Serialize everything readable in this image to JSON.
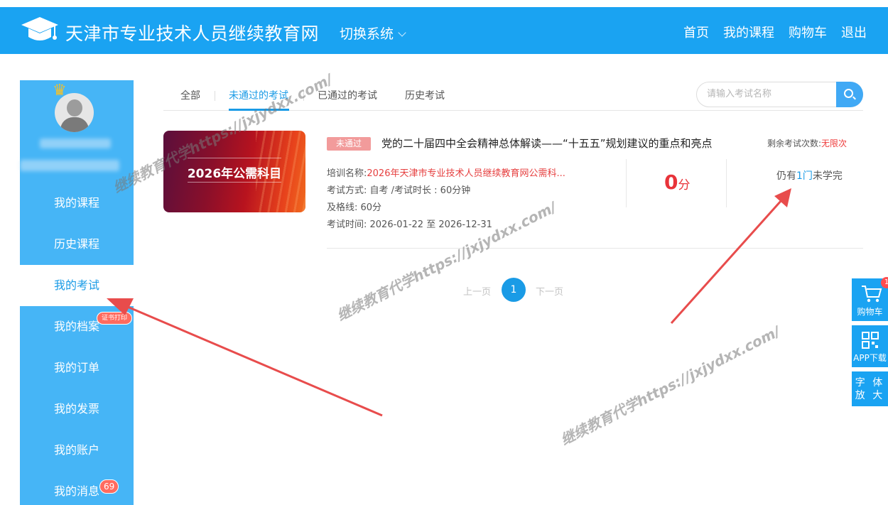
{
  "header": {
    "site_title": "天津市专业技术人员继续教育网",
    "switch_system": "切换系统",
    "nav": [
      "首页",
      "我的课程",
      "购物车",
      "退出"
    ]
  },
  "sidebar": {
    "items": [
      {
        "label": "我的课程"
      },
      {
        "label": "历史课程"
      },
      {
        "label": "我的考试"
      },
      {
        "label": "我的档案",
        "badge": "证书打印"
      },
      {
        "label": "我的订单"
      },
      {
        "label": "我的发票"
      },
      {
        "label": "我的账户"
      },
      {
        "label": "我的消息",
        "badge": "69"
      }
    ],
    "active_index": 2
  },
  "tabs": {
    "items": [
      "全部",
      "未通过的考试",
      "已通过的考试",
      "历史考试"
    ],
    "active": "未通过的考试"
  },
  "search": {
    "placeholder": "请输入考试名称"
  },
  "exam": {
    "thumbnail_title": "2026年公需科目",
    "status": "未通过",
    "title": "党的二十届四中全会精神总体解读——“十五五”规划建议的重点和亮点",
    "remaining_label": "剩余考试次数:",
    "remaining_value": "无限次",
    "training_label": "培训名称:",
    "training_value": "2026年天津市专业技术人员继续教育网公需科...",
    "method": "考试方式: 自考 /考试时长 : 60分钟",
    "passing": "及格线:  60分",
    "time": "考试时间: 2026-01-22 至 2026-12-31",
    "score_value": "0",
    "score_unit": "分",
    "unfinished_pre": "仍有",
    "unfinished_num": "1门",
    "unfinished_post": "未学完"
  },
  "pagination": {
    "prev": "上一页",
    "current": "1",
    "next": "下一页"
  },
  "float_tools": {
    "cart": "购物车",
    "cart_badge": "1",
    "app": "APP下载",
    "font_line1": "字 体",
    "font_line2": "放 大"
  },
  "watermark": "继续教育代学https://jxjydxx.com/",
  "colors": {
    "header": "#1aa3f2",
    "sidebar": "#46b5f6",
    "accent": "#1a9be6",
    "fail_tag": "#f29b9b",
    "score": "#e8333a",
    "arrow": "#e84c4c"
  }
}
